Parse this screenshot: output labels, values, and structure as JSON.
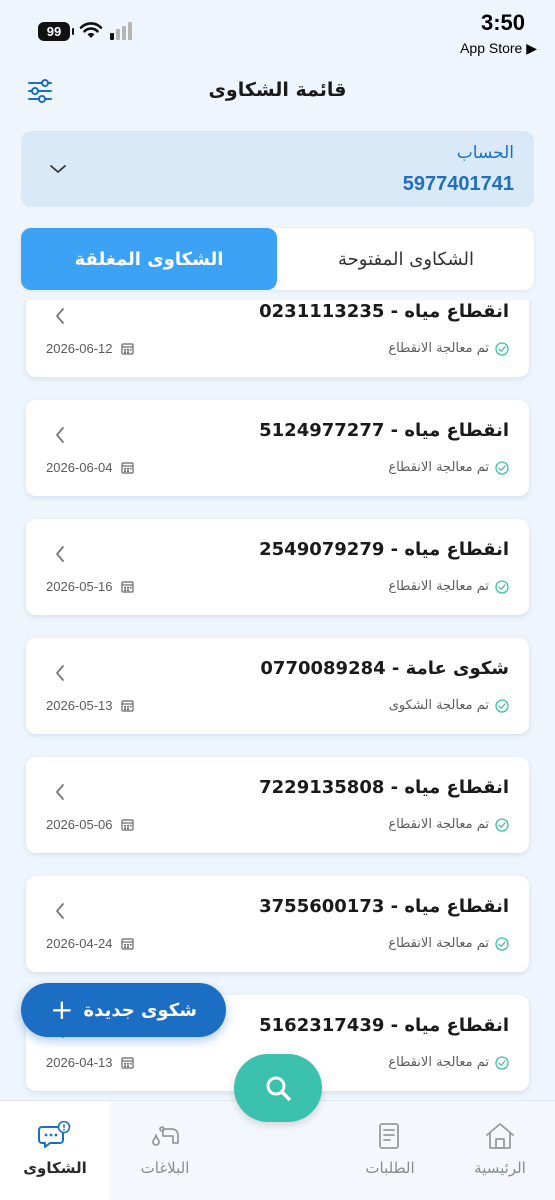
{
  "status_bar": {
    "battery": "99",
    "time": "3:50",
    "back_app": "App Store ▶"
  },
  "header": {
    "title": "قائمة الشكاوى",
    "filter_icon": "sliders-icon"
  },
  "account": {
    "label": "الحساب",
    "number": "5977401741"
  },
  "tabs": {
    "open": "الشكاوى المفتوحة",
    "closed": "الشكاوى المغلقة",
    "active": "closed"
  },
  "complaints": [
    {
      "title": "انقطاع مياه - 0231113235",
      "status": "تم معالجة الانقطاع",
      "date": "2026-06-12"
    },
    {
      "title": "انقطاع مياه - 5124977277",
      "status": "تم معالجة الانقطاع",
      "date": "2026-06-04"
    },
    {
      "title": "انقطاع مياه - 2549079279",
      "status": "تم معالجة الانقطاع",
      "date": "2026-05-16"
    },
    {
      "title": "شكوى عامة - 0770089284",
      "status": "تم معالجة الشكوى",
      "date": "2026-05-13"
    },
    {
      "title": "انقطاع مياه - 7229135808",
      "status": "تم معالجة الانقطاع",
      "date": "2026-05-06"
    },
    {
      "title": "انقطاع مياه - 3755600173",
      "status": "تم معالجة الانقطاع",
      "date": "2026-04-24"
    },
    {
      "title": "انقطاع مياه - 5162317439",
      "status": "تم معالجة الانقطاع",
      "date": "2026-04-13"
    }
  ],
  "new_complaint_button": "شكوى جديدة",
  "bottom_nav": {
    "complaints": "الشكاوى",
    "reports": "البلاغات",
    "requests": "الطلبات",
    "home": "الرئيسية",
    "active": "complaints"
  },
  "colors": {
    "primary": "#1c6dc4",
    "tab_active": "#3ba2f5",
    "search_fab": "#3bc1ae",
    "status_check": "#3bbfa8"
  }
}
